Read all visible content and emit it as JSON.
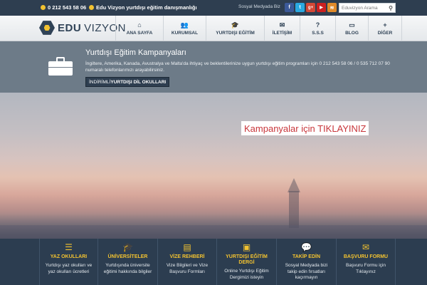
{
  "topbar": {
    "phone": "0 212 543 58 06",
    "tagline": "Edu Vizyon yurtdışı eğitim danışmanlığı",
    "social_label": "Sosyal Medyada Biz",
    "social_icons": [
      {
        "name": "facebook-icon",
        "glyph": "f",
        "color": "#3b5998"
      },
      {
        "name": "twitter-icon",
        "glyph": "t",
        "color": "#2aa9e0"
      },
      {
        "name": "google-plus-icon",
        "glyph": "g+",
        "color": "#d34836"
      },
      {
        "name": "youtube-icon",
        "glyph": "▶",
        "color": "#cc2020"
      },
      {
        "name": "rss-icon",
        "glyph": "≋",
        "color": "#e08a2a"
      }
    ],
    "search_placeholder": "Eduvizyon Arama"
  },
  "logo": {
    "edu": "EDU",
    "vizyon": "VIZYON"
  },
  "nav": [
    {
      "label": "ANA SAYFA",
      "icon": "home-icon",
      "glyph": "⌂"
    },
    {
      "label": "KURUMSAL",
      "icon": "users-icon",
      "glyph": "👥"
    },
    {
      "label": "YURTDIŞI EĞİTİM",
      "icon": "graduation-cap-icon",
      "glyph": "🎓"
    },
    {
      "label": "İLETİŞİM",
      "icon": "envelope-icon",
      "glyph": "✉"
    },
    {
      "label": "S.S.S",
      "icon": "question-icon",
      "glyph": "?"
    },
    {
      "label": "BLOG",
      "icon": "monitor-icon",
      "glyph": "▭"
    },
    {
      "label": "DİĞER",
      "icon": "plus-icon",
      "glyph": "+"
    }
  ],
  "campaign": {
    "title": "Yurtdışı Eğitim Kampanyaları",
    "text": "İngiltere, Amerika, Kanada, Avustralya ve Malta'da ihtiyaç ve beklentilerinize uygun yurtdışı eğitim programları için 0 212 543 58 06 / 0 535 712 07 90 numaralı telefonlarımızı arayabilirsiniz.",
    "button_prefix": "İNDİRİMLİ",
    "button_main": "YURTDIŞI DİL OKULLARI"
  },
  "hero": {
    "cta": "Kampanyalar için TIKLAYINIZ"
  },
  "features": [
    {
      "title": "YAZ OKULLARI",
      "desc": "Yurtdışı yaz okulları ve yaz okulları ücretleri",
      "icon": "list-icon",
      "glyph": "☰"
    },
    {
      "title": "ÜNİVERSİTELER",
      "desc": "Yurtdışında üniversite eğitimi hakkında bilgiler",
      "icon": "graduation-cap-icon",
      "glyph": "🎓"
    },
    {
      "title": "VİZE REHBERİ",
      "desc": "Vize Bilgileri ve Vize Başvuru Formları",
      "icon": "document-icon",
      "glyph": "▤"
    },
    {
      "title": "YURTDIŞI EĞİTİM DERGİ",
      "desc": "Online Yurtdışı Eğitim Dergimizi isteyin",
      "icon": "pdf-icon",
      "glyph": "▣"
    },
    {
      "title": "TAKİP EDİN",
      "desc": "Sosyal Medyada bizi takip edin fırsatları kaçırmayın",
      "icon": "chat-icon",
      "glyph": "💬"
    },
    {
      "title": "BAŞVURU FORMU",
      "desc": "Başvuru Formu için Tıklayınız",
      "icon": "envelope-icon",
      "glyph": "✉"
    }
  ]
}
